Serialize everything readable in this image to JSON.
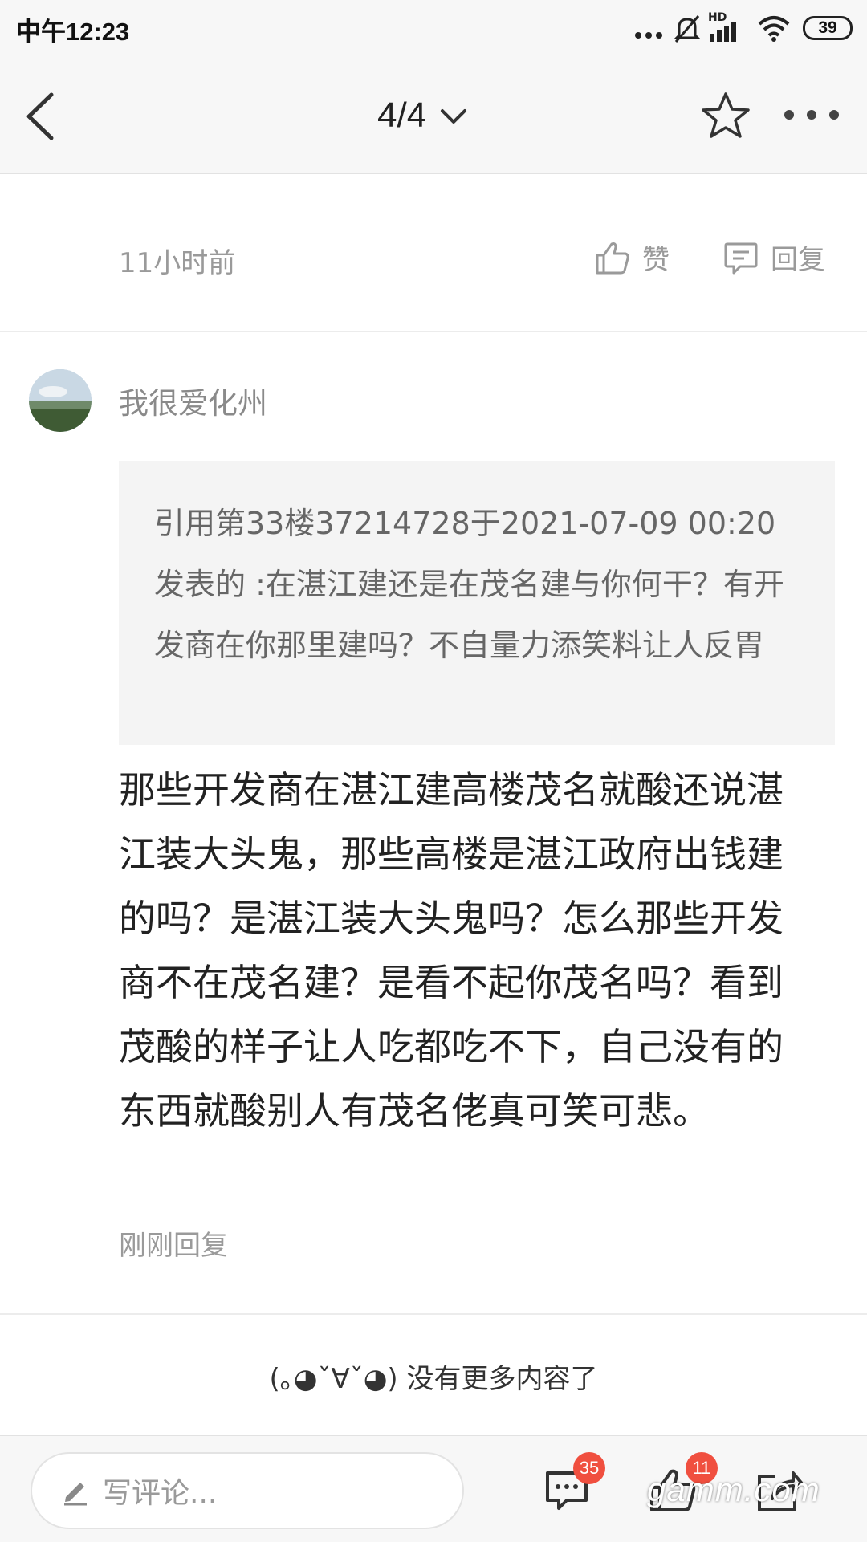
{
  "status_bar": {
    "time": "中午12:23",
    "battery": "39",
    "network_label": "HD"
  },
  "nav": {
    "page": "4/4"
  },
  "prev_comment": {
    "time": "11小时前",
    "like_label": "赞",
    "reply_label": "回复"
  },
  "comment": {
    "username": "我很爱化州",
    "quote": "引用第33楼37214728于2021-07-09 00:20发表的 :在湛江建还是在茂名建与你何干？有开发商在你那里建吗？不自量力添笑料让人反胃",
    "body": "那些开发商在湛江建高楼茂名就酸还说湛江装大头鬼，那些高楼是湛江政府出钱建的吗？是湛江装大头鬼吗？怎么那些开发商不在茂名建？是看不起你茂名吗？看到茂酸的样子让人吃都吃不下，自己没有的东西就酸别人有茂名佬真可笑可悲。",
    "status": "刚刚回复"
  },
  "end_message": "(｡◕ˇ∀ˇ◕) 没有更多内容了",
  "bottom_bar": {
    "placeholder": "写评论...",
    "comment_count": "35",
    "like_count": "11",
    "watermark": "gamm.com"
  },
  "colors": {
    "badge": "#f04f3f",
    "bar_bg": "#f7f7f7",
    "quote_bg": "#f4f4f4"
  }
}
